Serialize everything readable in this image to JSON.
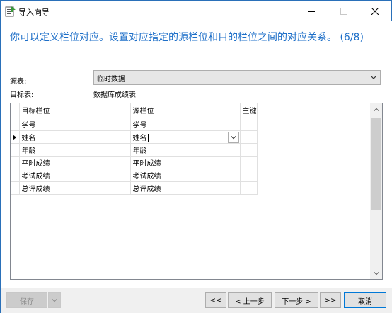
{
  "window": {
    "title": "导入向导"
  },
  "headline": "你可以定义栏位对应。设置对应指定的源栏位和目的栏位之间的对应关系。 (6/8)",
  "source": {
    "label": "源表:",
    "value": "临时数据"
  },
  "target": {
    "label": "目标表:",
    "value": "数据库成绩表"
  },
  "grid": {
    "columns": [
      "目标栏位",
      "源栏位",
      "主键"
    ],
    "rows": [
      {
        "target": "学号",
        "source": "学号"
      },
      {
        "target": "姓名",
        "source": "姓名"
      },
      {
        "target": "年龄",
        "source": "年龄"
      },
      {
        "target": "平时成绩",
        "source": "平时成绩"
      },
      {
        "target": "考试成绩",
        "source": "考试成绩"
      },
      {
        "target": "总评成绩",
        "source": "总评成绩"
      }
    ],
    "current_row": 1
  },
  "footer": {
    "save_label": "保存",
    "first_label": "<<",
    "prev_label": "< 上一步",
    "next_label": "下一步 >",
    "last_label": ">>",
    "cancel_label": "取消"
  },
  "icons": {
    "app": "import-wizard-icon",
    "dropdown": "chevron-down-icon"
  }
}
